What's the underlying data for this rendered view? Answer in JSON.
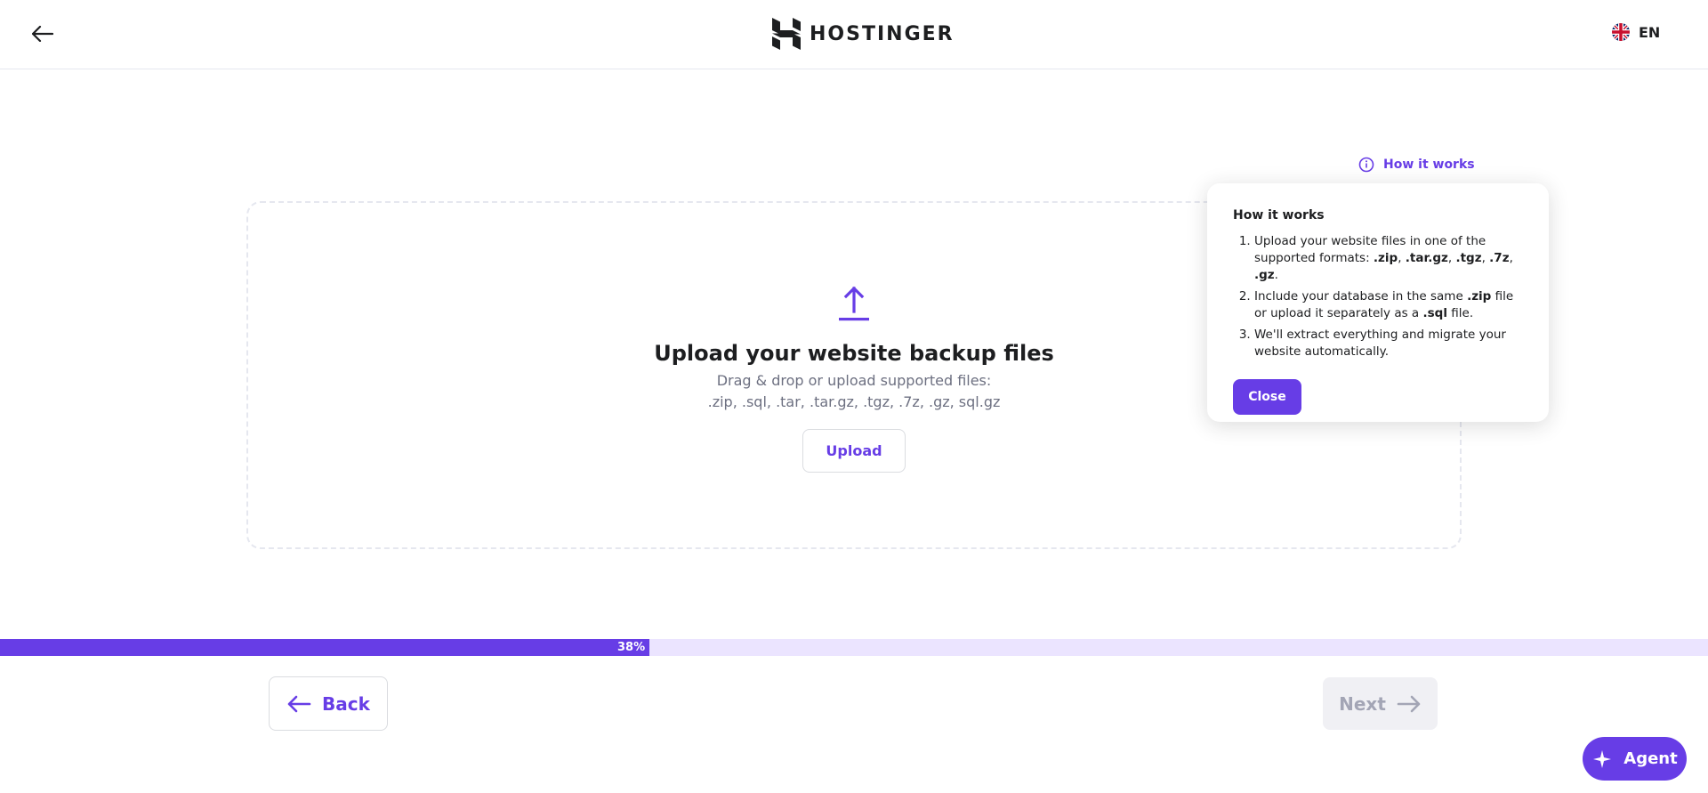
{
  "header": {
    "logo_text": "HOSTINGER",
    "language": "EN",
    "icons": [
      "back-arrow-icon",
      "hostinger-logo-icon",
      "uk-flag-icon"
    ]
  },
  "how_it_works_link": "How it works",
  "dropzone": {
    "title": "Upload your website backup files",
    "subtitle_line1": "Drag & drop or upload supported files:",
    "subtitle_line2": ".zip, .sql, .tar, .tar.gz, .tgz, .7z, .gz, sql.gz",
    "upload_button": "Upload"
  },
  "popover": {
    "title": "How it works",
    "close_button": "Close"
  },
  "progress": {
    "percent": 38,
    "label": "38%"
  },
  "footer": {
    "back_button": "Back",
    "next_button": "Next",
    "agent_button": "Agent"
  },
  "colors": {
    "accent": "#673de6",
    "progress_track": "#ebe4ff",
    "disabled_bg": "#f0f0f4",
    "disabled_text": "#a3a5b5"
  }
}
